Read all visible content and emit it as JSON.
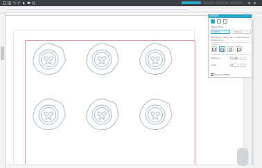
{
  "toolbar": {
    "icons": [
      "file-icon",
      "grid-icon",
      "undo-icon",
      "redo-icon",
      "cursor-icon",
      "heart-icon",
      "shape-icon"
    ],
    "tabs": [
      {
        "label": "",
        "active": true
      },
      {
        "label": "",
        "active": false
      },
      {
        "label": "",
        "active": false
      },
      {
        "label": "",
        "active": false
      }
    ]
  },
  "document": {
    "design_name": "wax-seal",
    "items": 6
  },
  "panel": {
    "title": "Offset",
    "section_style": "Offset Style",
    "option_a": "Outline",
    "option_b": "Internal",
    "hint": "Offsetting - when you created this as Outline on it",
    "section_corner": "Corner",
    "distance_label": "Distance",
    "distance_value": "0.125",
    "angle_label": "Angle",
    "angle_value": "0",
    "release_label": "Release Offset"
  },
  "colors": {
    "accent": "#2aa8c8",
    "mat_border": "#f09aa8",
    "seal_stroke": "#9fb4c8"
  }
}
